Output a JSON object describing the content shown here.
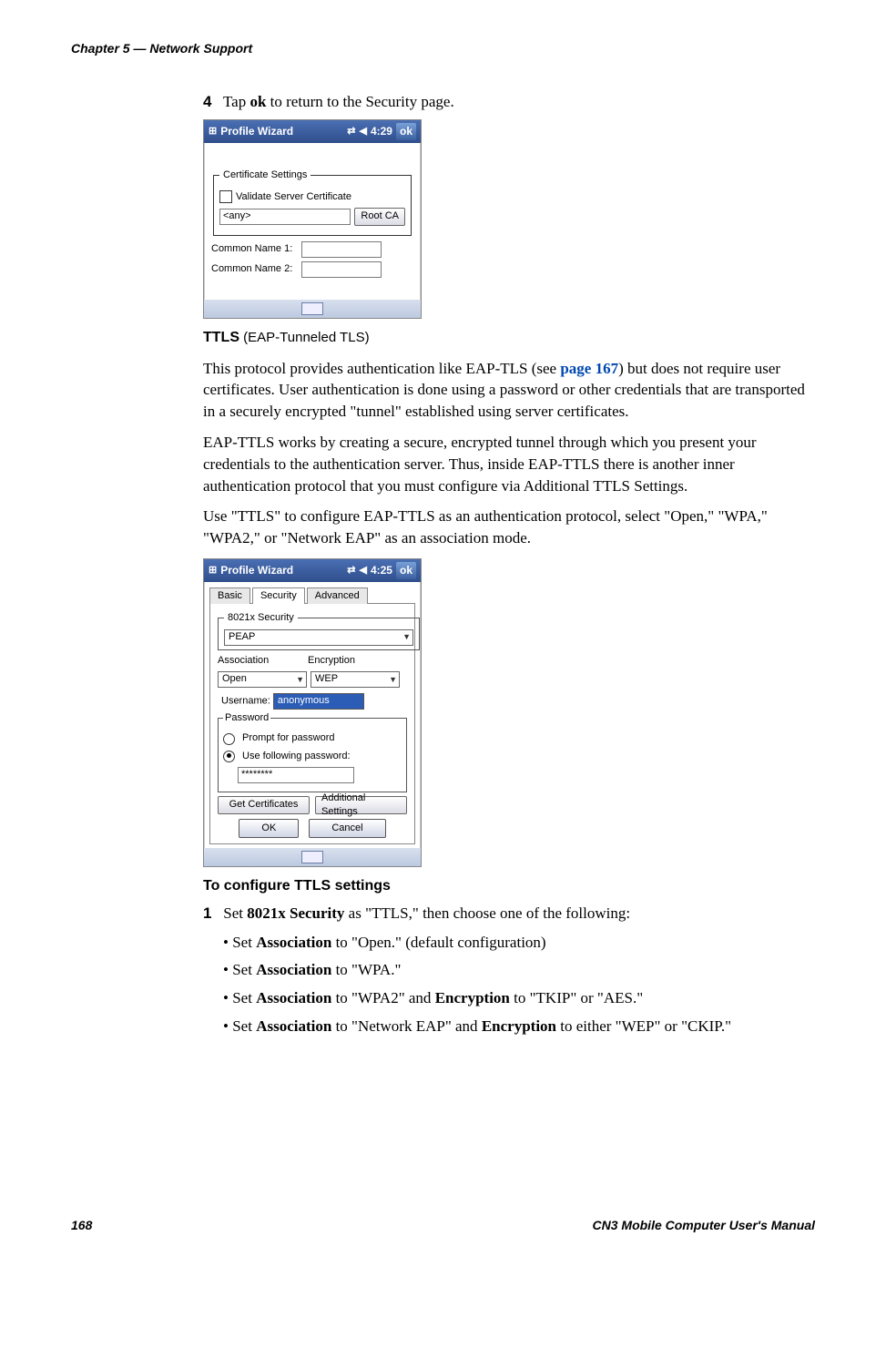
{
  "header": {
    "chapter_text": "Chapter 5 — Network Support"
  },
  "footer": {
    "page_number": "168",
    "manual_title": "CN3 Mobile Computer User's Manual"
  },
  "step4": {
    "num": "4",
    "text_prefix": "Tap ",
    "text_bold": "ok",
    "text_suffix": " to return to the Security page."
  },
  "screenshot1": {
    "titlebar": {
      "start_glyph": "⊞",
      "title": "Profile Wizard",
      "net_glyph": "⇄",
      "vol_glyph": "◀",
      "time": "4:29",
      "ok": "ok"
    },
    "cert_legend": "Certificate Settings",
    "cert_checkbox_label": "Validate Server Certificate",
    "cert_any": "<any>",
    "cert_rootca": "Root CA",
    "cert_cn1": "Common Name 1:",
    "cert_cn2": "Common Name 2:"
  },
  "ttls_heading": {
    "strong": "TTLS",
    "rest": " (EAP-Tunneled TLS)"
  },
  "para1_before": "This protocol provides authentication like EAP-TLS (see ",
  "para1_link": "page 167",
  "para1_after": ") but does not require user certificates. User authentication is done using a password or other credentials that are transported in a securely encrypted \"tunnel\" established using server certificates.",
  "para2": "EAP-TTLS works by creating a secure, encrypted tunnel through which you present your credentials to the authentication server. Thus, inside EAP-TTLS there is another inner authentication protocol that you must configure via Additional TTLS Settings.",
  "para3": "Use \"TTLS\" to configure EAP-TTLS as an authentication protocol, select \"Open,\" \"WPA,\" \"WPA2,\" or \"Network EAP\" as an association mode.",
  "screenshot2": {
    "titlebar": {
      "start_glyph": "⊞",
      "title": "Profile Wizard",
      "net_glyph": "⇄",
      "vol_glyph": "◀",
      "time": "4:25",
      "ok": "ok"
    },
    "tabs": {
      "basic": "Basic",
      "security": "Security",
      "advanced": "Advanced"
    },
    "sec_legend": "8021x Security",
    "sec_combo": "PEAP",
    "assoc_label": "Association",
    "assoc_val": "Open",
    "enc_label": "Encryption",
    "enc_val": "WEP",
    "user_label": "Username:",
    "user_val": "anonymous",
    "pwd_legend": "Password",
    "pwd_opt1": "Prompt for password",
    "pwd_opt2": "Use following password:",
    "pwd_val": "********",
    "btn_getcerts": "Get Certificates",
    "btn_addl": "Additional Settings",
    "btn_ok": "OK",
    "btn_cancel": "Cancel"
  },
  "configure_heading": "To configure TTLS settings",
  "step1": {
    "num": "1",
    "text_prefix": "Set ",
    "text_bold": "8021x Security",
    "text_suffix": " as \"TTLS,\" then choose one of the following:"
  },
  "bullets": {
    "b1_pre": "Set ",
    "b1_bold": "Association",
    "b1_suf": " to \"Open.\" (default configuration)",
    "b2_pre": "Set ",
    "b2_bold": "Association",
    "b2_suf": " to \"WPA.\"",
    "b3_pre": "Set ",
    "b3_b1": "Association",
    "b3_mid": " to \"WPA2\" and ",
    "b3_b2": "Encryption",
    "b3_suf": " to \"TKIP\" or \"AES.\"",
    "b4_pre": "Set ",
    "b4_b1": "Association",
    "b4_mid": " to \"Network EAP\" and ",
    "b4_b2": "Encryption",
    "b4_suf": " to either \"WEP\" or \"CKIP.\""
  }
}
